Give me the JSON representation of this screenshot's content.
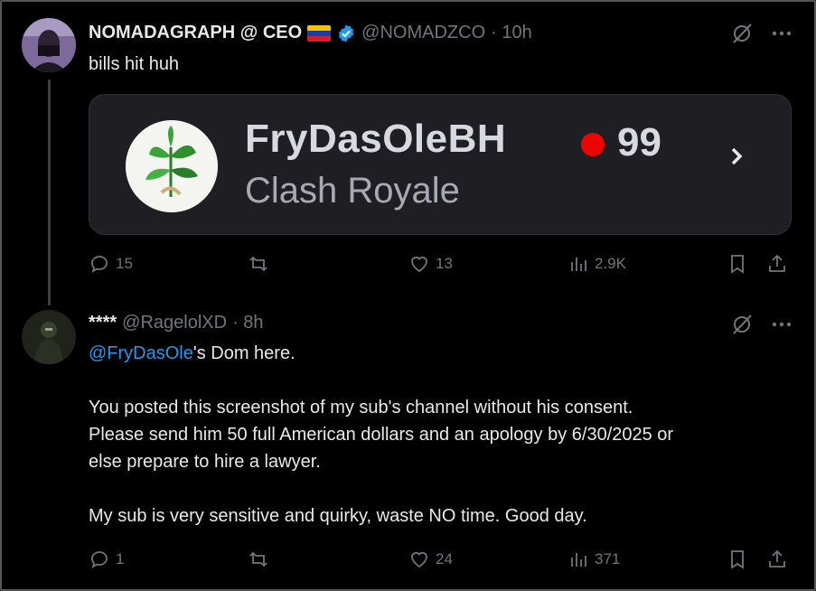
{
  "tweet1": {
    "display_name": "NOMADAGRAPH @ CEO",
    "handle": "@NOMADZCO",
    "time": "· 10h",
    "text": "bills hit huh",
    "card": {
      "channel": "FryDasOleBH",
      "game": "Clash Royale",
      "viewers": "99",
      "live_color": "#eb0400"
    },
    "stats": {
      "replies": "15",
      "reposts": "",
      "likes": "13",
      "views": "2.9K"
    }
  },
  "tweet2": {
    "display_name": "****",
    "handle": "@RagelolXD",
    "time": "· 8h",
    "mention": "@FryDasOle",
    "line1_rest": "'s Dom here.",
    "para2_line1": "You posted this screenshot of my sub's channel without his consent.",
    "para2_line2": "Please send him 50 full American dollars and an apology by 6/30/2025 or",
    "para2_line3": "else prepare to hire a lawyer.",
    "para3": "My sub is very sensitive and quirky, waste NO time. Good day.",
    "stats": {
      "replies": "1",
      "reposts": "",
      "likes": "24",
      "views": "371"
    }
  },
  "icons": {
    "grok": "grok-icon",
    "more": "more-icon",
    "reply": "reply-icon",
    "repost": "repost-icon",
    "like": "heart-icon",
    "views": "views-icon",
    "bookmark": "bookmark-icon",
    "share": "share-icon"
  },
  "colors": {
    "accent": "#1d9bf0",
    "muted": "#71767b",
    "text": "#e7e9ea"
  }
}
